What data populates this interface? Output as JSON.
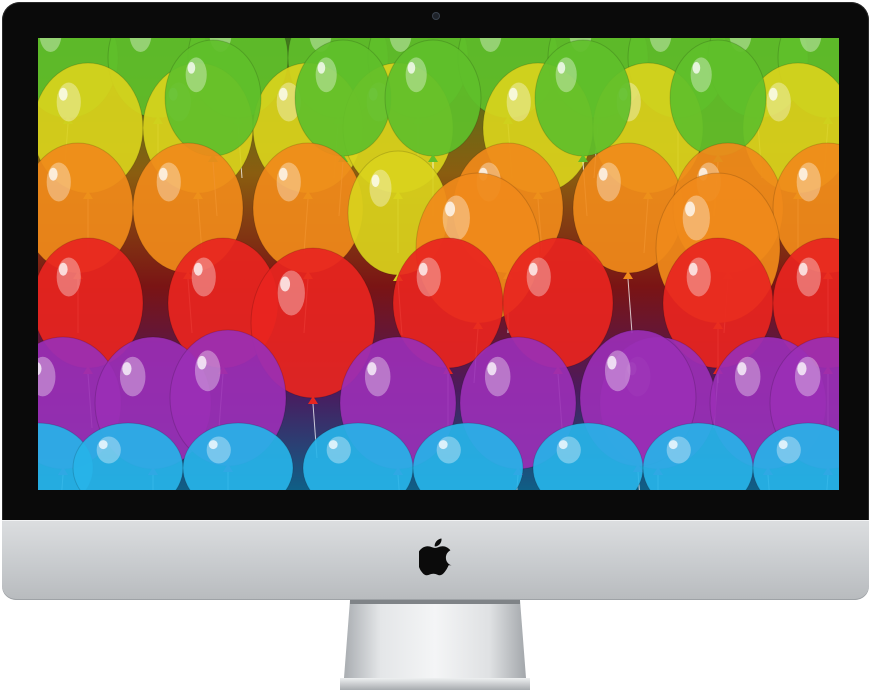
{
  "device": {
    "type": "desktop monitor",
    "bezel_color": "#0a0a0a",
    "chin_color": "#c8cbce",
    "logo_icon": "apple-logo-icon"
  },
  "wallpaper": {
    "subject": "balloons",
    "palette": {
      "green": "#5fbf2a",
      "yellow": "#d9d21c",
      "orange": "#f08a1a",
      "red": "#e8251f",
      "purple": "#9a2fb5",
      "blue": "#27b3e8"
    }
  }
}
